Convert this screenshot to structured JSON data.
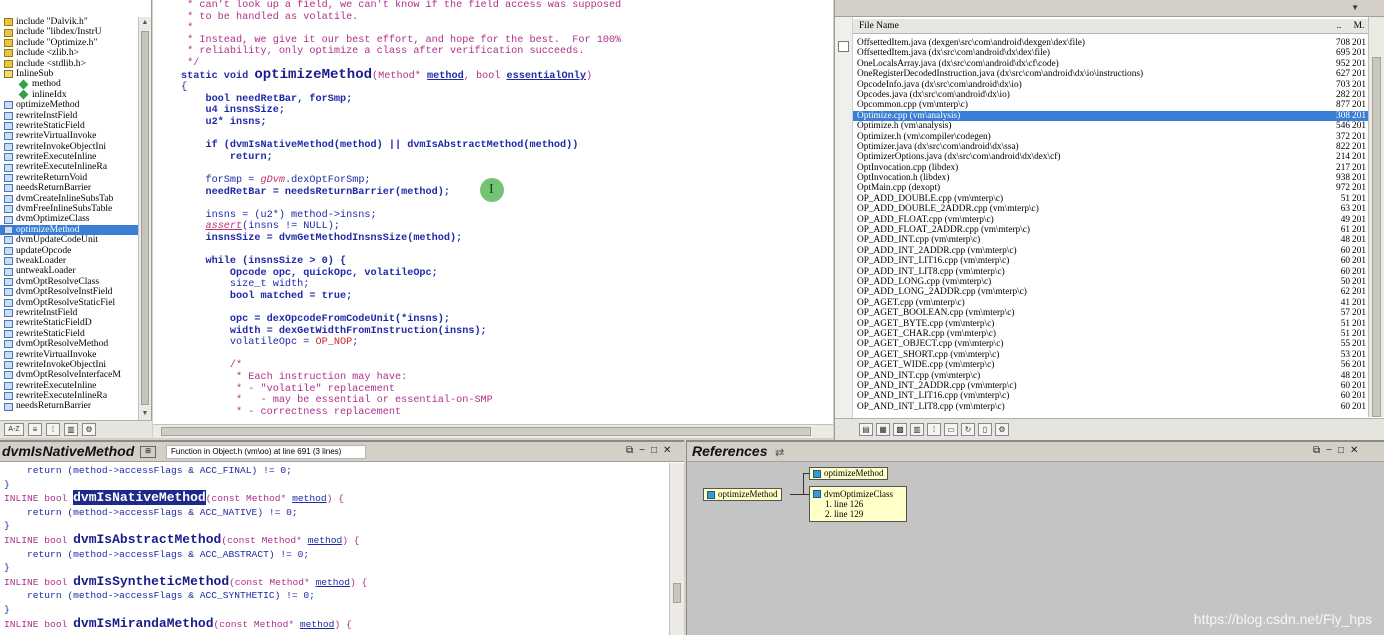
{
  "symbols": {
    "items": [
      {
        "label": "include \"Dalvik.h\"",
        "kind": "include"
      },
      {
        "label": "include \"libdex/InstrU",
        "kind": "include"
      },
      {
        "label": "include \"Optimize.h\"",
        "kind": "include"
      },
      {
        "label": "include <zlib.h>",
        "kind": "include"
      },
      {
        "label": "include <stdlib.h>",
        "kind": "include"
      },
      {
        "label": "InlineSub",
        "kind": "struct"
      },
      {
        "label": "method",
        "kind": "member"
      },
      {
        "label": "inlineIdx",
        "kind": "member"
      },
      {
        "label": "optimizeMethod",
        "kind": "func"
      },
      {
        "label": "rewriteInstField",
        "kind": "func"
      },
      {
        "label": "rewriteStaticField",
        "kind": "func"
      },
      {
        "label": "rewriteVirtualInvoke",
        "kind": "func"
      },
      {
        "label": "rewriteInvokeObjectIni",
        "kind": "func"
      },
      {
        "label": "rewriteExecuteInline",
        "kind": "func"
      },
      {
        "label": "rewriteExecuteInlineRa",
        "kind": "func"
      },
      {
        "label": "rewriteReturnVoid",
        "kind": "func"
      },
      {
        "label": "needsReturnBarrier",
        "kind": "func"
      },
      {
        "label": "dvmCreateInlineSubsTab",
        "kind": "func"
      },
      {
        "label": "dvmFreeInlineSubsTable",
        "kind": "func"
      },
      {
        "label": "dvmOptimizeClass",
        "kind": "func"
      },
      {
        "label": "optimizeMethod",
        "kind": "func",
        "selected": true
      },
      {
        "label": "dvmUpdateCodeUnit",
        "kind": "func"
      },
      {
        "label": "updateOpcode",
        "kind": "func"
      },
      {
        "label": "tweakLoader",
        "kind": "func"
      },
      {
        "label": "untweakLoader",
        "kind": "func"
      },
      {
        "label": "dvmOptResolveClass",
        "kind": "func"
      },
      {
        "label": "dvmOptResolveInstField",
        "kind": "func"
      },
      {
        "label": "dvmOptResolveStaticFiel",
        "kind": "func"
      },
      {
        "label": "rewriteInstField",
        "kind": "func"
      },
      {
        "label": "rewriteStaticFieldD",
        "kind": "func"
      },
      {
        "label": "rewriteStaticField",
        "kind": "func"
      },
      {
        "label": "dvmOptResolveMethod",
        "kind": "func"
      },
      {
        "label": "rewriteVirtualInvoke",
        "kind": "func"
      },
      {
        "label": "rewriteInvokeObjectIni",
        "kind": "func"
      },
      {
        "label": "dvmOptResolveInterfaceM",
        "kind": "func"
      },
      {
        "label": "rewriteExecuteInline",
        "kind": "func"
      },
      {
        "label": "rewriteExecuteInlineRa",
        "kind": "func"
      },
      {
        "label": "needsReturnBarrier",
        "kind": "func"
      }
    ],
    "toolbar_az": "A-Z"
  },
  "editor": {
    "comment_line_1": " * can't look up a field, we can't know if the field access was supposed",
    "comment_line_2": " * to be handled as volatile.",
    "comment_line_3": " *",
    "comment_line_4": " * Instead, we give it our best effort, and hope for the best.  For 100%",
    "comment_line_5": " * reliability, only optimize a class after verification succeeds.",
    "comment_line_6": " */",
    "sig_prefix": "static void ",
    "sig_name": "optimizeMethod",
    "sig_open": "(Method* ",
    "sig_p1": "method",
    "sig_mid": ", bool ",
    "sig_p2": "essentialOnly",
    "sig_close": ")",
    "brace_open": "{",
    "decl_1": "    bool needRetBar, forSmp;",
    "decl_2": "    u4 insnsSize;",
    "decl_3": "    u2* insns;",
    "if_line_a": "    if (dvmIsNativeMethod(method) || dvmIsAbstractMethod(method))",
    "if_line_b": "        return;",
    "forSmp_a": "    forSmp = ",
    "forSmp_b": "gDvm",
    "forSmp_c": ".dexOptForSmp;",
    "needRetBar": "    needRetBar = needsReturnBarrier(method);",
    "insns_line": "    insns = (u2*) method->insns;",
    "assert_a": "    ",
    "assert_b": "assert",
    "assert_c": "(insns != NULL);",
    "insnsSize_line": "    insnsSize = dvmGetMethodInsnsSize(method);",
    "while_line": "    while (insnsSize > 0) {",
    "w1": "        Opcode opc, quickOpc, volatileOpc;",
    "w2": "        size_t width;",
    "w3": "        bool matched = true;",
    "w4": "        opc = dexOpcodeFromCodeUnit(*insns);",
    "w5": "        width = dexGetWidthFromInstruction(insns);",
    "w6a": "        volatileOpc = ",
    "w6b": "OP_NOP",
    "w6c": ";",
    "c1": "        /*",
    "c2": "         * Each instruction may have:",
    "c3": "         * - \"volatile\" replacement",
    "c4": "         *   - may be essential or essential-on-SMP",
    "c5": "         * - correctness replacement"
  },
  "files": {
    "header": {
      "name": "File Name",
      "size": "..",
      "type": "M."
    },
    "rows": [
      {
        "name": "OffsettedItem.java (dexgen\\src\\com\\android\\dexgen\\dex\\file)",
        "size": "708",
        "type": "201"
      },
      {
        "name": "OffsettedItem.java (dx\\src\\com\\android\\dx\\dex\\file)",
        "size": "695",
        "type": "201"
      },
      {
        "name": "OneLocalsArray.java (dx\\src\\com\\android\\dx\\cf\\code)",
        "size": "952",
        "type": "201"
      },
      {
        "name": "OneRegisterDecodedInstruction.java (dx\\src\\com\\android\\dx\\io\\instructions)",
        "size": "627",
        "type": "201"
      },
      {
        "name": "OpcodeInfo.java (dx\\src\\com\\android\\dx\\io)",
        "size": "703",
        "type": "201"
      },
      {
        "name": "Opcodes.java (dx\\src\\com\\android\\dx\\io)",
        "size": "282",
        "type": "201"
      },
      {
        "name": "Opcommon.cpp (vm\\mterp\\c)",
        "size": "877",
        "type": "201"
      },
      {
        "name": "Optimize.cpp (vm\\analysis)",
        "size": "308",
        "type": "201",
        "selected": true
      },
      {
        "name": "Optimize.h (vm\\analysis)",
        "size": "546",
        "type": "201"
      },
      {
        "name": "Optimizer.h (vm\\compiler\\codegen)",
        "size": "372",
        "type": "201"
      },
      {
        "name": "Optimizer.java (dx\\src\\com\\android\\dx\\ssa)",
        "size": "822",
        "type": "201"
      },
      {
        "name": "OptimizerOptions.java (dx\\src\\com\\android\\dx\\dex\\cf)",
        "size": "214",
        "type": "201"
      },
      {
        "name": "OptInvocation.cpp (libdex)",
        "size": "217",
        "type": "201"
      },
      {
        "name": "OptInvocation.h (libdex)",
        "size": "938",
        "type": "201"
      },
      {
        "name": "OptMain.cpp (dexopt)",
        "size": "972",
        "type": "201"
      },
      {
        "name": "OP_ADD_DOUBLE.cpp (vm\\mterp\\c)",
        "size": "51",
        "type": "201"
      },
      {
        "name": "OP_ADD_DOUBLE_2ADDR.cpp (vm\\mterp\\c)",
        "size": "63",
        "type": "201"
      },
      {
        "name": "OP_ADD_FLOAT.cpp (vm\\mterp\\c)",
        "size": "49",
        "type": "201"
      },
      {
        "name": "OP_ADD_FLOAT_2ADDR.cpp (vm\\mterp\\c)",
        "size": "61",
        "type": "201"
      },
      {
        "name": "OP_ADD_INT.cpp (vm\\mterp\\c)",
        "size": "48",
        "type": "201"
      },
      {
        "name": "OP_ADD_INT_2ADDR.cpp (vm\\mterp\\c)",
        "size": "60",
        "type": "201"
      },
      {
        "name": "OP_ADD_INT_LIT16.cpp (vm\\mterp\\c)",
        "size": "60",
        "type": "201"
      },
      {
        "name": "OP_ADD_INT_LIT8.cpp (vm\\mterp\\c)",
        "size": "60",
        "type": "201"
      },
      {
        "name": "OP_ADD_LONG.cpp (vm\\mterp\\c)",
        "size": "50",
        "type": "201"
      },
      {
        "name": "OP_ADD_LONG_2ADDR.cpp (vm\\mterp\\c)",
        "size": "62",
        "type": "201"
      },
      {
        "name": "OP_AGET.cpp (vm\\mterp\\c)",
        "size": "41",
        "type": "201"
      },
      {
        "name": "OP_AGET_BOOLEAN.cpp (vm\\mterp\\c)",
        "size": "57",
        "type": "201"
      },
      {
        "name": "OP_AGET_BYTE.cpp (vm\\mterp\\c)",
        "size": "51",
        "type": "201"
      },
      {
        "name": "OP_AGET_CHAR.cpp (vm\\mterp\\c)",
        "size": "51",
        "type": "201"
      },
      {
        "name": "OP_AGET_OBJECT.cpp (vm\\mterp\\c)",
        "size": "55",
        "type": "201"
      },
      {
        "name": "OP_AGET_SHORT.cpp (vm\\mterp\\c)",
        "size": "53",
        "type": "201"
      },
      {
        "name": "OP_AGET_WIDE.cpp (vm\\mterp\\c)",
        "size": "56",
        "type": "201"
      },
      {
        "name": "OP_AND_INT.cpp (vm\\mterp\\c)",
        "size": "48",
        "type": "201"
      },
      {
        "name": "OP_AND_INT_2ADDR.cpp (vm\\mterp\\c)",
        "size": "60",
        "type": "201"
      },
      {
        "name": "OP_AND_INT_LIT16.cpp (vm\\mterp\\c)",
        "size": "60",
        "type": "201"
      },
      {
        "name": "OP_AND_INT_LIT8.cpp (vm\\mterp\\c)",
        "size": "60",
        "type": "201"
      }
    ]
  },
  "context": {
    "title": "dvmIsNativeMethod",
    "description": "Function in Object.h (vm\\oo) at line 691 (3 lines)",
    "l0a": "    return (method->accessFlags & ACC_FINAL) != 0;",
    "l1": "}",
    "inline_kw": "INLINE bool ",
    "f1": "dvmIsNativeMethod",
    "f2": "dvmIsAbstractMethod",
    "f3": "dvmIsSyntheticMethod",
    "f4": "dvmIsMirandaMethod",
    "param_open": "(const Method* ",
    "param_name": "method",
    "param_close": ") {",
    "r1": "    return (method->accessFlags & ACC_NATIVE) != 0;",
    "r2": "    return (method->accessFlags & ACC_ABSTRACT) != 0;",
    "r3": "    return (method->accessFlags & ACC_SYNTHETIC) != 0;"
  },
  "refs": {
    "title": "References",
    "root": "optimizeMethod",
    "caller_1": "optimizeMethod",
    "caller_2": "dvmOptimizeClass",
    "line_1": "1. line 126",
    "line_2": "2. line 129"
  },
  "watermark": "https://blog.csdn.net/Fly_hps"
}
